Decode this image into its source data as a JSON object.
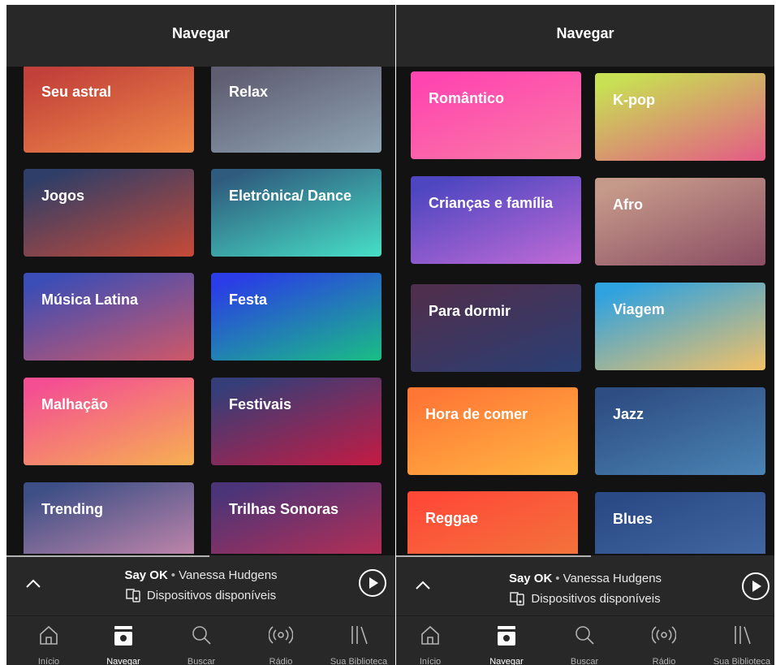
{
  "left": {
    "header_title": "Navegar",
    "tiles": [
      {
        "label": "Seu astral",
        "gradient": [
          "#c2403a",
          "#ef8a48"
        ]
      },
      {
        "label": "Relax",
        "gradient": [
          "#5f5d72",
          "#8fa5b4"
        ]
      },
      {
        "label": "Jogos",
        "gradient": [
          "#2e3e68",
          "#c84a37"
        ]
      },
      {
        "label": "Eletrônica/ Dance",
        "gradient": [
          "#2f5c7e",
          "#47dfc7"
        ]
      },
      {
        "label": "Música Latina",
        "gradient": [
          "#3b4db6",
          "#d05868"
        ]
      },
      {
        "label": "Festa",
        "gradient": [
          "#2a3de6",
          "#1abe84"
        ]
      },
      {
        "label": "Malhação",
        "gradient": [
          "#f44f92",
          "#f6b052"
        ]
      },
      {
        "label": "Festivais",
        "gradient": [
          "#353e78",
          "#c41b43"
        ]
      },
      {
        "label": "Trending",
        "gradient": [
          "#3d4f86",
          "#cf8cae"
        ]
      },
      {
        "label": "Trilhas Sonoras",
        "gradient": [
          "#4b3578",
          "#c12d51"
        ]
      }
    ],
    "player": {
      "title": "Say OK",
      "separator": "•",
      "artist": "Vanessa Hudgens",
      "devices": "Dispositivos disponíveis"
    },
    "tabs": [
      {
        "label": "Início",
        "icon": "home-icon"
      },
      {
        "label": "Navegar",
        "icon": "browse-icon"
      },
      {
        "label": "Buscar",
        "icon": "search-icon"
      },
      {
        "label": "Rádio",
        "icon": "radio-icon"
      },
      {
        "label": "Sua Biblioteca",
        "icon": "library-icon"
      }
    ]
  },
  "right": {
    "header_title": "Navegar",
    "tiles": [
      {
        "label": "Romântico",
        "gradient": [
          "#ff45b0",
          "#f97aa5"
        ]
      },
      {
        "label": "K-pop",
        "gradient": [
          "#c8e053",
          "#e45a86"
        ]
      },
      {
        "label": "Crianças e família",
        "gradient": [
          "#4d46c0",
          "#c06bd6"
        ]
      },
      {
        "label": "Afro",
        "gradient": [
          "#c69a8a",
          "#8a4d63"
        ]
      },
      {
        "label": "Para dormir",
        "gradient": [
          "#4e2f4e",
          "#2a3f74"
        ]
      },
      {
        "label": "Viagem",
        "gradient": [
          "#2fa2e0",
          "#f3c166"
        ]
      },
      {
        "label": "Hora de comer",
        "gradient": [
          "#ff7735",
          "#ffb743"
        ]
      },
      {
        "label": "Jazz",
        "gradient": [
          "#2e4d83",
          "#4a84b4"
        ]
      },
      {
        "label": "Reggae",
        "gradient": [
          "#ff4a38",
          "#f07c3c"
        ]
      },
      {
        "label": "Blues",
        "gradient": [
          "#2a4a86",
          "#476da6"
        ]
      }
    ],
    "player": {
      "title": "Say OK",
      "separator": "•",
      "artist": "Vanessa Hudgens",
      "devices": "Dispositivos disponíveis"
    },
    "tabs": [
      {
        "label": "Início",
        "icon": "home-icon"
      },
      {
        "label": "Navegar",
        "icon": "browse-icon"
      },
      {
        "label": "Buscar",
        "icon": "search-icon"
      },
      {
        "label": "Rádio",
        "icon": "radio-icon"
      },
      {
        "label": "Sua Biblioteca",
        "icon": "library-icon"
      }
    ]
  },
  "active_tab": "Navegar",
  "colors": {
    "background": "#121212",
    "bar": "#282828",
    "inactive_text": "#b3b3b3"
  }
}
